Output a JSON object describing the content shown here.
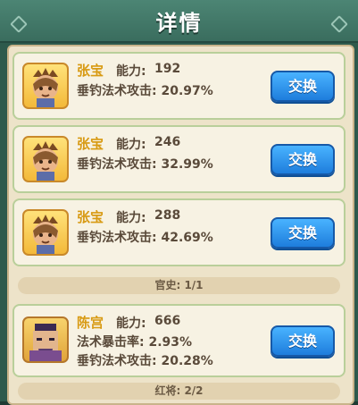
{
  "header": {
    "title": "详情"
  },
  "cards": [
    {
      "name": "张宝",
      "ability_label": "能力:",
      "ability_value": "192",
      "stats": [
        "垂钓法术攻击: 20.97%"
      ],
      "button": "交换"
    },
    {
      "name": "张宝",
      "ability_label": "能力:",
      "ability_value": "246",
      "stats": [
        "垂钓法术攻击: 32.99%"
      ],
      "button": "交换"
    },
    {
      "name": "张宝",
      "ability_label": "能力:",
      "ability_value": "288",
      "stats": [
        "垂钓法术攻击: 42.69%"
      ],
      "button": "交换"
    },
    {
      "name": "陈宫",
      "ability_label": "能力:",
      "ability_value": "666",
      "stats": [
        "法术暴击率: 2.93%",
        "垂钓法术攻击: 20.28%"
      ],
      "button": "交换"
    }
  ],
  "separators": [
    "官史: 1/1",
    "红将: 2/2"
  ]
}
